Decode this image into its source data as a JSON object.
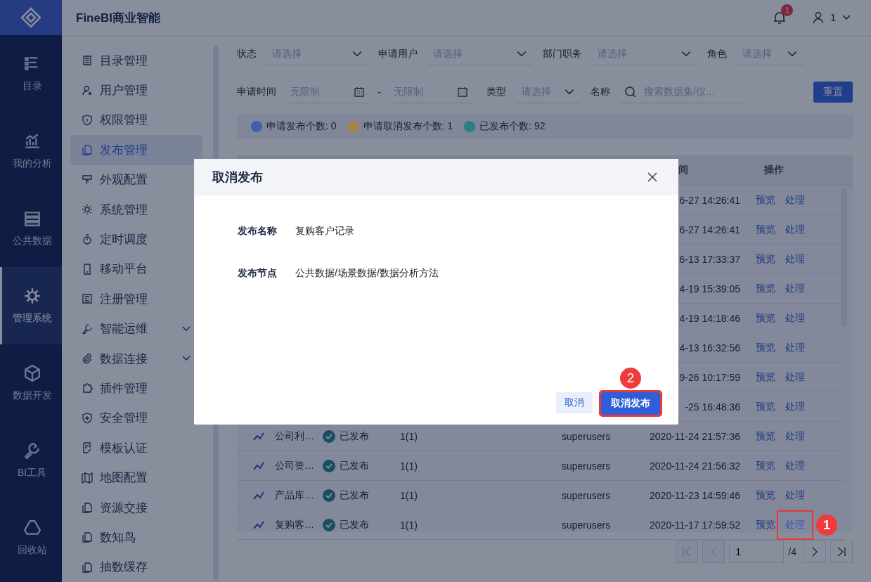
{
  "app": {
    "title": "FineBI商业智能",
    "notification_count": "1",
    "user": "1"
  },
  "nav": [
    {
      "label": "目录",
      "selected": false
    },
    {
      "label": "我的分析",
      "selected": false
    },
    {
      "label": "公共数据",
      "selected": false
    },
    {
      "label": "管理系统",
      "selected": true
    },
    {
      "label": "数据开发",
      "selected": false
    },
    {
      "label": "BI工具",
      "selected": false
    },
    {
      "label": "回收站",
      "selected": false
    }
  ],
  "sidebar": {
    "items": [
      {
        "label": "目录管理",
        "selected": false
      },
      {
        "label": "用户管理",
        "selected": false
      },
      {
        "label": "权限管理",
        "selected": false
      },
      {
        "label": "发布管理",
        "selected": true
      },
      {
        "label": "外观配置",
        "selected": false
      },
      {
        "label": "系统管理",
        "selected": false
      },
      {
        "label": "定时调度",
        "selected": false
      },
      {
        "label": "移动平台",
        "selected": false
      },
      {
        "label": "注册管理",
        "selected": false
      },
      {
        "label": "智能运维",
        "selected": false,
        "expanded": false
      },
      {
        "label": "数据连接",
        "selected": false,
        "expanded": false
      },
      {
        "label": "插件管理",
        "selected": false
      },
      {
        "label": "安全管理",
        "selected": false
      },
      {
        "label": "模板认证",
        "selected": false
      },
      {
        "label": "地图配置",
        "selected": false
      },
      {
        "label": "资源交接",
        "selected": false
      },
      {
        "label": "数知鸟",
        "selected": false
      },
      {
        "label": "抽数缓存",
        "selected": false
      }
    ]
  },
  "filters": {
    "row_1": [
      {
        "kind": "select",
        "label": "状态",
        "placeholder": "请选择"
      },
      {
        "kind": "select",
        "label": "申请用户",
        "placeholder": "请选择"
      },
      {
        "kind": "select",
        "label": "部门职务",
        "placeholder": "请选择"
      },
      {
        "kind": "select",
        "label": "角色",
        "placeholder": "请选择"
      }
    ],
    "row_2": [
      {
        "kind": "date_range",
        "label": "申请时间",
        "from_placeholder": "无限制",
        "separator": "-",
        "to_placeholder": "无限制"
      },
      {
        "kind": "select",
        "label": "类型",
        "placeholder": "请选择"
      },
      {
        "kind": "search",
        "label": "名称",
        "placeholder": "搜索数据集/仪…"
      }
    ],
    "reset_button": "重置"
  },
  "summary": [
    {
      "label": "申请发布个数: 0",
      "color": "#3f5fa8"
    },
    {
      "label": "申请取消发布个数: 1",
      "color": "#a8804a"
    },
    {
      "label": "已发布个数: 92",
      "color": "#2b7f80"
    }
  ],
  "table": {
    "columns": [
      "间",
      "操作"
    ],
    "rows": [
      {
        "time": "6-27 14:26:41",
        "actions": [
          {
            "label": "预览"
          },
          {
            "label": "处理"
          }
        ]
      },
      {
        "time": "6-27 14:26:41",
        "actions": [
          {
            "label": "预览"
          },
          {
            "label": "处理"
          }
        ]
      },
      {
        "time": "6-13 17:33:37",
        "actions": [
          {
            "label": "预览"
          },
          {
            "label": "处理"
          }
        ]
      },
      {
        "time": "4-19 15:39:05",
        "actions": [
          {
            "label": "预览"
          },
          {
            "label": "处理"
          }
        ]
      },
      {
        "time": "4-19 14:18:46",
        "actions": [
          {
            "label": "预览"
          },
          {
            "label": "处理"
          }
        ]
      },
      {
        "time": "4-13 16:32:56",
        "actions": [
          {
            "label": "预览"
          },
          {
            "label": "处理"
          }
        ]
      },
      {
        "time": "9-26 10:17:59",
        "actions": [
          {
            "label": "预览"
          },
          {
            "label": "处理"
          }
        ]
      },
      {
        "time": "-25 16:48:36",
        "actions": [
          {
            "label": "预览"
          },
          {
            "label": "处理"
          }
        ]
      },
      {
        "name": "公司利…",
        "status": {
          "kind": "published",
          "label": "已发布"
        },
        "version": "1(1)",
        "user": "superusers",
        "time": "2020-11-24 21:57:36",
        "actions": [
          {
            "label": "预览"
          },
          {
            "label": "处理"
          }
        ]
      },
      {
        "name": "公司资…",
        "status": {
          "kind": "published",
          "label": "已发布"
        },
        "version": "1(1)",
        "user": "superusers",
        "time": "2020-11-24 21:56:32",
        "actions": [
          {
            "label": "预览"
          },
          {
            "label": "处理"
          }
        ]
      },
      {
        "name": "产品库…",
        "status": {
          "kind": "published",
          "label": "已发布"
        },
        "version": "1(1)",
        "user": "superusers",
        "time": "2020-11-23 14:59:46",
        "actions": [
          {
            "label": "预览"
          },
          {
            "label": "处理"
          }
        ]
      },
      {
        "name": "复购客…",
        "status": {
          "kind": "published",
          "label": "已发布"
        },
        "version": "1(1)",
        "user": "superusers",
        "time": "2020-11-17 17:59:52",
        "actions": [
          {
            "label": "预览"
          },
          {
            "label": "处理",
            "highlighted": true,
            "callout": "1"
          }
        ]
      }
    ]
  },
  "pagination": {
    "page": "1",
    "total": "/4",
    "first_disabled": true,
    "prev_disabled": true
  },
  "modal": {
    "title": "取消发布",
    "fields": [
      {
        "label": "发布名称",
        "value": "复购客户记录"
      },
      {
        "label": "发布节点",
        "value": "公共数据/场景数据/数据分析方法"
      }
    ],
    "buttons": [
      {
        "kind": "secondary",
        "label": "取消"
      },
      {
        "kind": "primary",
        "label": "取消发布",
        "highlighted": true,
        "callout": "2"
      }
    ]
  }
}
